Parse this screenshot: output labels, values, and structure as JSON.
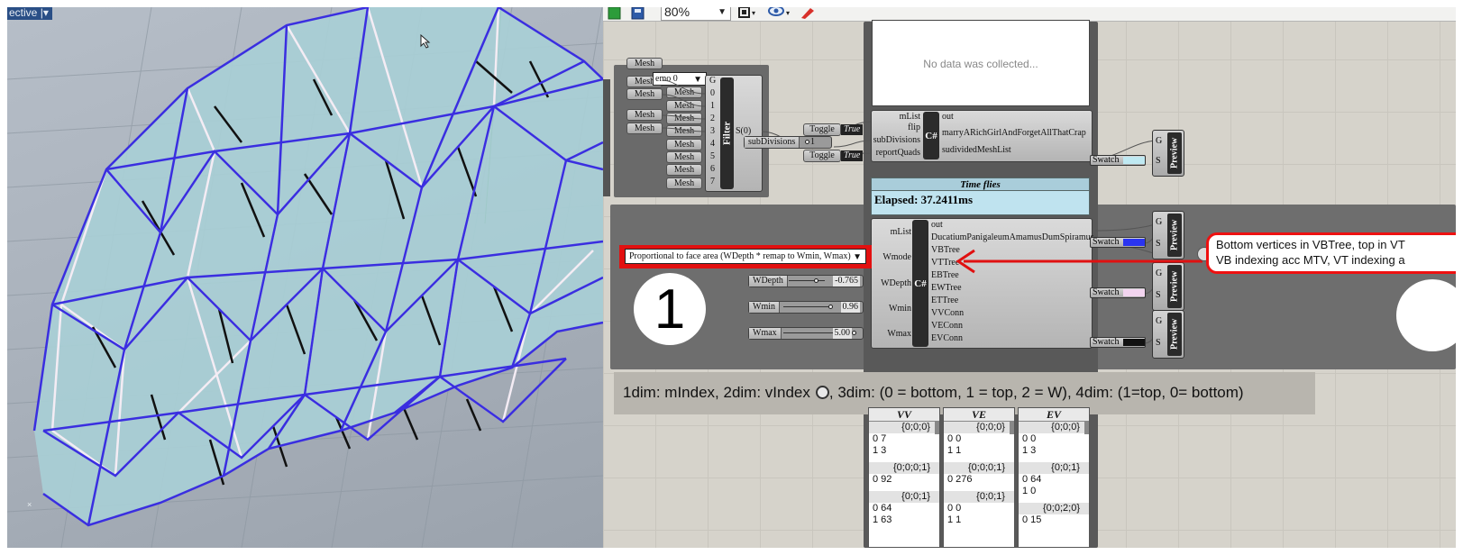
{
  "viewport": {
    "label": "ective",
    "label_suffix": "|▾"
  },
  "toolbar": {
    "zoom_value": "80%"
  },
  "filter_group": {
    "input_params": [
      "Mesh",
      "Mesh",
      "Mesh",
      "Mesh",
      "Mesh"
    ],
    "dropdown_value": "emo 0",
    "filter_inputs": [
      "G",
      "0",
      "1",
      "2",
      "3",
      "4",
      "5",
      "6",
      "7"
    ],
    "output_params": [
      "Mesh",
      "Mesh",
      "Mesh",
      "Mesh",
      "Mesh",
      "Mesh",
      "Mesh",
      "Mesh"
    ],
    "filter_name": "Filter",
    "filter_output": "S(0)"
  },
  "toggles": {
    "flip_label": "Toggle",
    "flip_value": "True",
    "quads_label": "Toggle",
    "quads_value": "True",
    "subdivisions_label": "subDivisions",
    "subdivisions_value": "1"
  },
  "csharp_top": {
    "name": "C#",
    "inputs": [
      "mList",
      "flip",
      "subDivisions",
      "reportQuads"
    ],
    "outputs": [
      "out",
      "marryARichGirlAndForgetAllThatCrap",
      "sudividedMeshList"
    ],
    "panel_text": "No data was collected..."
  },
  "timer": {
    "title": "Time flies",
    "elapsed": "Elapsed: 37.2411ms"
  },
  "csharp_main": {
    "name": "C#",
    "inputs": [
      "mList",
      "Wmode",
      "WDepth",
      "Wmin",
      "Wmax"
    ],
    "outputs": [
      "out",
      "DucatiumPanigaleumAmamusDumSpiramus",
      "VBTree",
      "VTTree",
      "EBTree",
      "EWTree",
      "ETTree",
      "VVConn",
      "VEConn",
      "EVConn"
    ],
    "mode_dropdown": "Proportional to face area (WDepth * remap to Wmin, Wmax)",
    "sliders": [
      {
        "label": "WDepth",
        "value": "-0.765",
        "fraction": 0.6
      },
      {
        "label": "Wmin",
        "value": "0.96",
        "fraction": 0.88
      },
      {
        "label": "Wmax",
        "value": "5.00",
        "fraction": 1.0
      }
    ]
  },
  "swatches": [
    {
      "label": "Swatch",
      "color": "#bfe9f2"
    },
    {
      "label": "Swatch",
      "color": "#2a34f0"
    },
    {
      "label": "Swatch",
      "color": "#f2d4ef"
    },
    {
      "label": "Swatch",
      "color": "#111111"
    }
  ],
  "previews": [
    {
      "name": "Preview",
      "g": "G",
      "s": "S"
    },
    {
      "name": "Preview",
      "g": "G",
      "s": "S"
    },
    {
      "name": "Preview",
      "g": "G",
      "s": "S"
    },
    {
      "name": "Preview",
      "g": "G",
      "s": "S"
    }
  ],
  "step_number": "1",
  "scribble": {
    "line1": "Bottom vertices in VBTree, top in VT",
    "line2": "VB indexing acc MTV, VT indexing a"
  },
  "dimension_text": {
    "before": "1dim: mIndex, 2dim: vIndex",
    "after": ", 3dim: (0 = bottom, 1 = top, 2 = W), 4dim: (1=top, 0= bottom)"
  },
  "panels": [
    {
      "title": "VV",
      "path1": "{0;0;0}",
      "rows1": [
        "0  7",
        "1  3"
      ],
      "path2": "{0;0;0;1}",
      "rows2": [
        "0  92"
      ],
      "path3": "{0;0;1}",
      "rows3": [
        "0  64",
        "1  63"
      ]
    },
    {
      "title": "VE",
      "path1": "{0;0;0}",
      "rows1": [
        "0  0",
        "1  1"
      ],
      "path2": "{0;0;0;1}",
      "rows2": [
        "0  276"
      ],
      "path3": "{0;0;1}",
      "rows3": [
        "0  0",
        "1  1"
      ]
    },
    {
      "title": "EV",
      "path1": "{0;0;0}",
      "rows1": [
        "0  0",
        "1  3"
      ],
      "path2": "{0;0;1}",
      "rows2": [
        "0  64",
        "1  0"
      ],
      "path3": "{0;0;2;0}",
      "rows3": [
        "0  15"
      ]
    }
  ],
  "colors": {
    "mesh_blue": "#3a2ee0",
    "mesh_fill": "#a9cfd6",
    "annotation_red": "#e01010",
    "canvas_bg": "#d6d3cb"
  }
}
